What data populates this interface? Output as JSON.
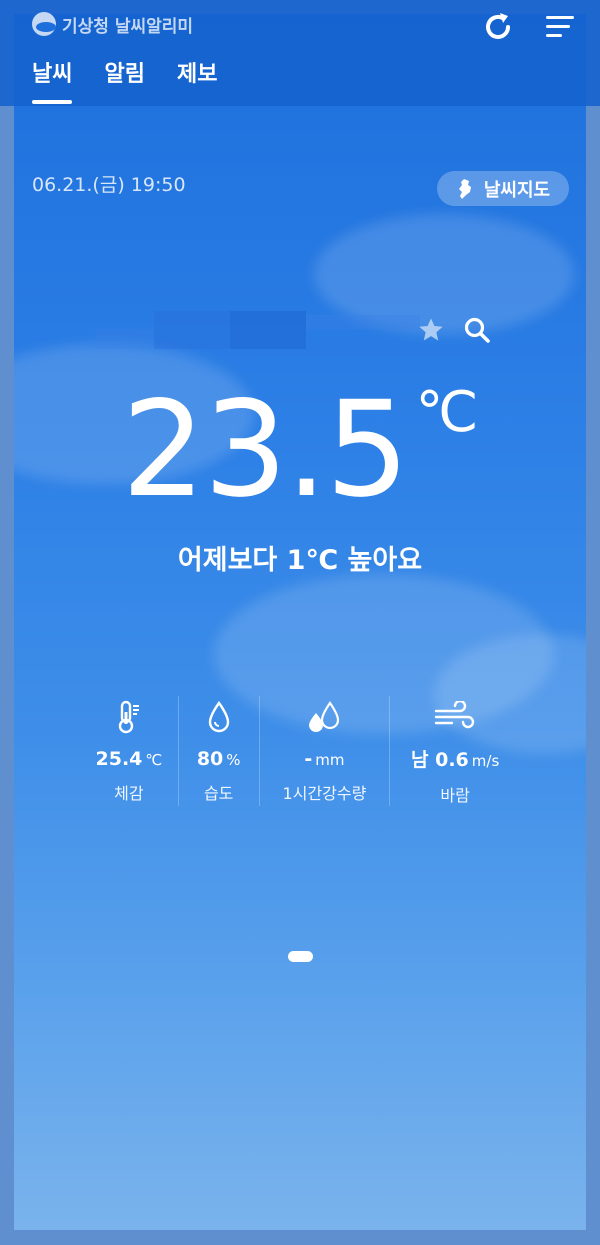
{
  "app": {
    "logo_text": "기상청 날씨알리미"
  },
  "header": {
    "refresh_icon": "refresh-icon",
    "menu_icon": "hamburger-menu-icon",
    "tabs": [
      {
        "label": "날씨",
        "active": true
      },
      {
        "label": "알림",
        "active": false
      },
      {
        "label": "제보",
        "active": false
      }
    ]
  },
  "main": {
    "datetime": "06.21.(금) 19:50",
    "map_button_label": "날씨지도",
    "temperature": "23.5",
    "temperature_unit": "℃",
    "comparison": "어제보다 1℃ 높아요"
  },
  "stats": [
    {
      "icon": "thermometer-icon",
      "value": "25.4",
      "unit": "℃",
      "label": "체감"
    },
    {
      "icon": "water-drop-icon",
      "value": "80",
      "unit": "%",
      "label": "습도"
    },
    {
      "icon": "rain-drops-icon",
      "value": "-",
      "unit": "mm",
      "label": "1시간강수량"
    },
    {
      "icon": "wind-icon",
      "value": "남 0.6",
      "unit": "m/s",
      "label": "바람"
    }
  ],
  "colors": {
    "sky_top": "#1d6fdc",
    "sky_bottom": "#7ab3ec",
    "accent": "#ffffff"
  }
}
